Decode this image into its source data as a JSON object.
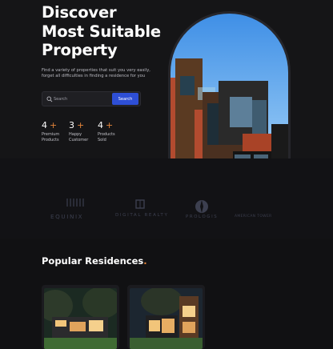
{
  "hero": {
    "title_lines": [
      "Discover",
      "Most Suitable",
      "Property"
    ],
    "subtitle": "Find a variety of properties that suit you very easily, forget all difficulties in finding a residence for you",
    "search": {
      "placeholder": "Search",
      "button_label": "Search"
    },
    "stats": [
      {
        "number": "4",
        "plus": "+",
        "label": "Premium Products"
      },
      {
        "number": "3",
        "plus": "+",
        "label": "Happy Customer"
      },
      {
        "number": "4",
        "plus": "+",
        "label": "Products Sold"
      }
    ]
  },
  "partners": {
    "logos": [
      "EQUINIX",
      "DIGITAL REALTY",
      "PROLOGIS",
      "AMERICAN TOWER"
    ]
  },
  "residences": {
    "title": "Popular Residences",
    "title_dot": "."
  },
  "colors": {
    "accent": "#e3843a",
    "button": "#2e4fd6",
    "background": "#111113"
  }
}
